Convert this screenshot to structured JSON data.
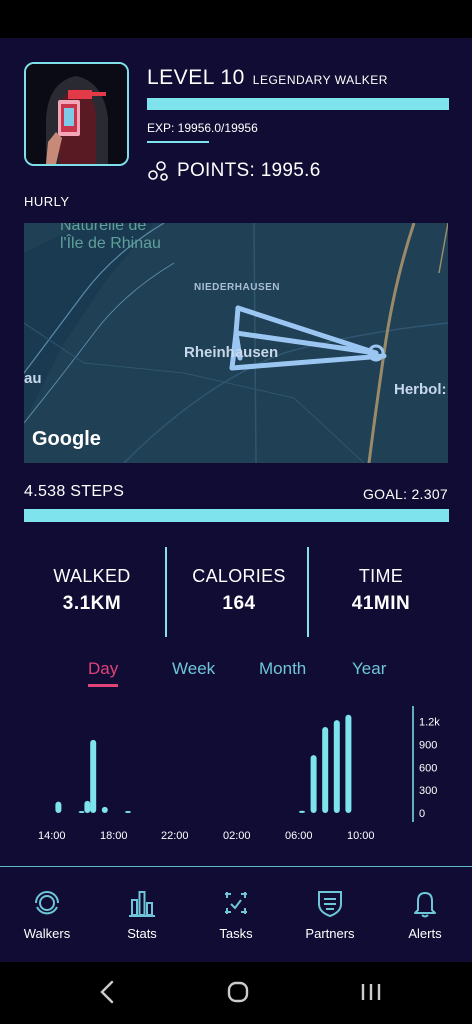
{
  "profile": {
    "level_title": "LEVEL 10",
    "level_sub": "LEGENDARY WALKER",
    "exp_text": "EXP: 19956.0/19956",
    "exp_progress": 1.0,
    "points_text": "POINTS: 1995.6",
    "points_icon": "bubbles-icon",
    "walker_name": "HURLY"
  },
  "map": {
    "labels": [
      "Naturelle de",
      "l'Île de Rhinau",
      "NIEDERHAUSEN",
      "Rheinhausen",
      "au",
      "Herbol:"
    ],
    "attribution": "Google"
  },
  "steps": {
    "steps_text": "4.538 STEPS",
    "goal_text": "GOAL: 2.307",
    "progress": 1.0
  },
  "stats": [
    {
      "label": "WALKED",
      "value": "3.1KM"
    },
    {
      "label": "CALORIES",
      "value": "164"
    },
    {
      "label": "TIME",
      "value": "41MIN"
    }
  ],
  "periods": [
    "Day",
    "Week",
    "Month",
    "Year"
  ],
  "active_period": "Day",
  "chart_data": {
    "type": "bar",
    "x_tick_labels": [
      "14:00",
      "18:00",
      "22:00",
      "02:00",
      "06:00",
      "10:00"
    ],
    "y_tick_labels": [
      "1.2k",
      "900",
      "600",
      "300",
      "0"
    ],
    "ylim": [
      0,
      1300
    ],
    "values": [
      0,
      0,
      0,
      150,
      0,
      0,
      0,
      20,
      160,
      960,
      0,
      80,
      0,
      0,
      0,
      20,
      0,
      0,
      0,
      0,
      0,
      0,
      0,
      0,
      0,
      0,
      0,
      0,
      0,
      0,
      0,
      0,
      0,
      0,
      0,
      0,
      0,
      0,
      0,
      0,
      0,
      0,
      0,
      0,
      0,
      30,
      0,
      760,
      0,
      1130,
      0,
      1220,
      0,
      1290
    ],
    "bar_color": "#7ee3ec"
  },
  "nav": [
    {
      "label": "Walkers",
      "icon": "walkers-icon"
    },
    {
      "label": "Stats",
      "icon": "stats-icon"
    },
    {
      "label": "Tasks",
      "icon": "tasks-icon"
    },
    {
      "label": "Partners",
      "icon": "partners-icon"
    },
    {
      "label": "Alerts",
      "icon": "bell-icon"
    }
  ],
  "colors": {
    "background": "#110c33",
    "accent": "#7ee3ec",
    "active": "#e0427a",
    "tab": "#6ec6d8"
  }
}
